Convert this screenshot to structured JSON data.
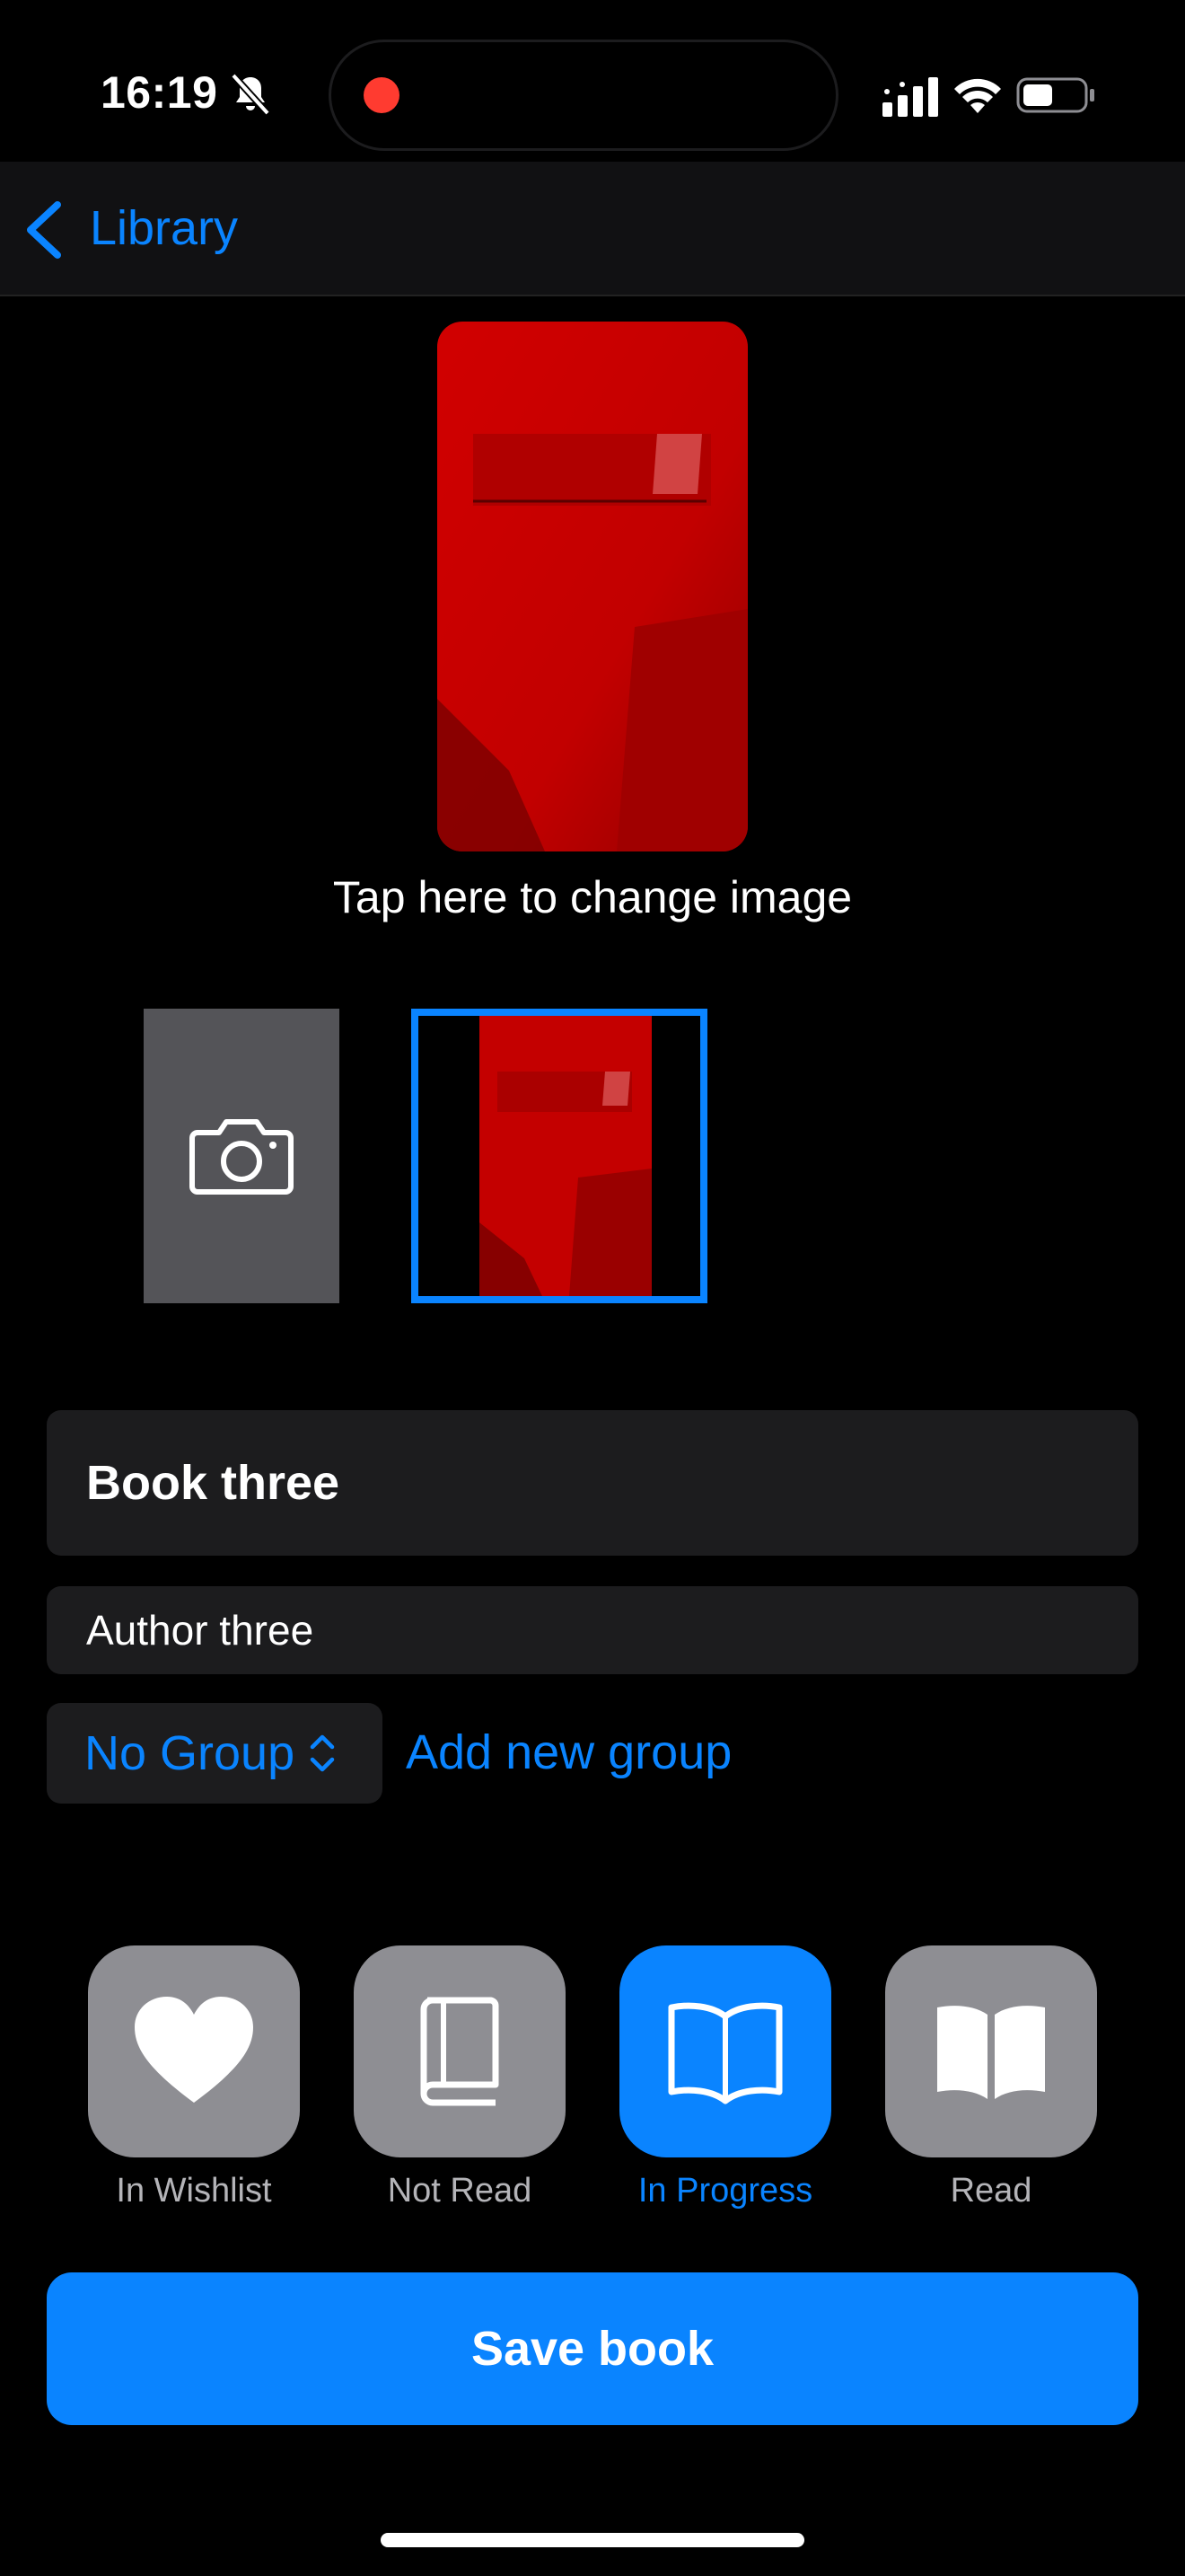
{
  "status_bar": {
    "time": "16:19",
    "icons": [
      "bell-slash-icon",
      "recording-dot",
      "cellular-signal-icon",
      "wifi-icon",
      "battery-icon"
    ],
    "recording_color": "#ff3b30"
  },
  "nav": {
    "back_label": "Library"
  },
  "cover": {
    "change_image_label": "Tap here to change image",
    "cover_color": "#c70000"
  },
  "thumbnails": {
    "camera_icon": "camera-icon",
    "selected_index": 1
  },
  "form": {
    "title_value": "Book three",
    "author_value": "Author three",
    "group_value": "No Group",
    "add_group_label": "Add new group"
  },
  "statuses": [
    {
      "label": "In Wishlist",
      "icon": "heart-icon",
      "active": false
    },
    {
      "label": "Not Read",
      "icon": "closed-book-icon",
      "active": false
    },
    {
      "label": "In Progress",
      "icon": "open-book-icon",
      "active": true
    },
    {
      "label": "Read",
      "icon": "open-book-filled-icon",
      "active": false
    }
  ],
  "save_label": "Save book",
  "colors": {
    "accent": "#0a84ff",
    "background": "#000000",
    "field": "#1c1c1e",
    "inactive_option": "#8e8e93"
  }
}
